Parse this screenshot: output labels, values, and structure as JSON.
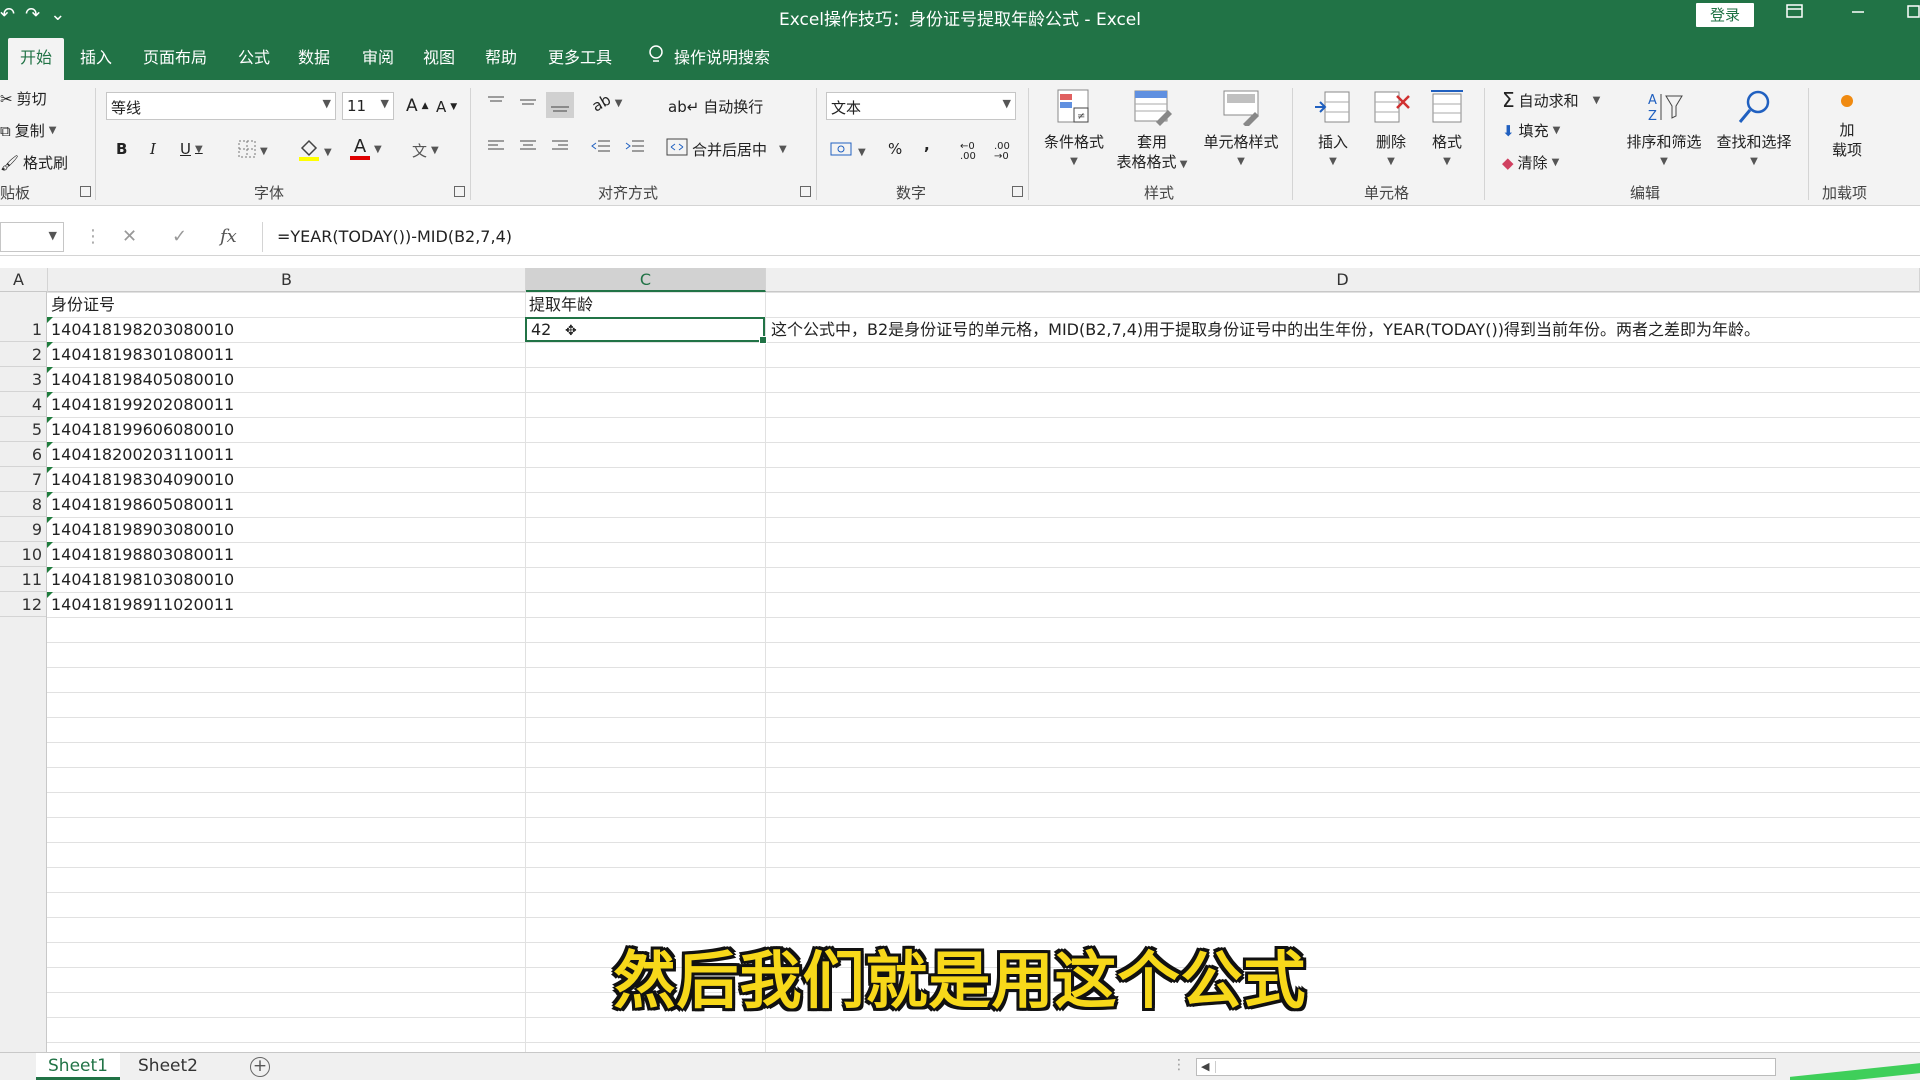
{
  "titlebar": {
    "title": "Excel操作技巧：身份证号提取年龄公式 - Excel",
    "login_label": "登录",
    "qat_undo": "↶",
    "qat_redo": "↷",
    "qat_more": "⌄"
  },
  "tabs": [
    {
      "label": "开始",
      "active": true
    },
    {
      "label": "插入"
    },
    {
      "label": "页面布局"
    },
    {
      "label": "公式"
    },
    {
      "label": "数据"
    },
    {
      "label": "审阅"
    },
    {
      "label": "视图"
    },
    {
      "label": "帮助"
    },
    {
      "label": "更多工具"
    }
  ],
  "tell_me": "操作说明搜索",
  "ribbon": {
    "clipboard": {
      "cut": "剪切",
      "copy": "复制",
      "format_painter": "格式刷",
      "group": "贴板"
    },
    "font": {
      "name": "等线",
      "size": "11",
      "bold": "B",
      "italic": "I",
      "underline": "U",
      "grow": "A",
      "shrink": "A",
      "color_letter": "A",
      "wen": "文",
      "group": "字体"
    },
    "alignment": {
      "wrap": "自动换行",
      "merge": "合并后居中",
      "group": "对齐方式"
    },
    "number": {
      "format": "文本",
      "percent": "%",
      "comma": ",",
      "group": "数字"
    },
    "styles": {
      "conditional": "条件格式",
      "table_1": "套用",
      "table_2": "表格格式",
      "cell_styles": "单元格样式",
      "group": "样式"
    },
    "cells": {
      "insert": "插入",
      "delete": "删除",
      "format": "格式",
      "group": "单元格"
    },
    "editing": {
      "autosum": "自动求和",
      "fill": "填充",
      "clear": "清除",
      "sort": "排序和筛选",
      "find": "查找和选择",
      "group": "编辑"
    },
    "addins": {
      "label_1": "加",
      "label_2": "载项",
      "group": "加载项"
    }
  },
  "formula_bar": {
    "fx": "fx",
    "formula": "=YEAR(TODAY())-MID(B2,7,4)"
  },
  "columns": [
    "A",
    "B",
    "C",
    "D"
  ],
  "headers": {
    "b": "身份证号",
    "c": "提取年龄"
  },
  "rows": [
    {
      "n": "1",
      "id": "140418198203080010",
      "age": "42"
    },
    {
      "n": "2",
      "id": "140418198301080011"
    },
    {
      "n": "3",
      "id": "140418198405080010"
    },
    {
      "n": "4",
      "id": "140418199202080011"
    },
    {
      "n": "5",
      "id": "140418199606080010"
    },
    {
      "n": "6",
      "id": "140418200203110011"
    },
    {
      "n": "7",
      "id": "140418198304090010"
    },
    {
      "n": "8",
      "id": "140418198605080011"
    },
    {
      "n": "9",
      "id": "140418198903080010"
    },
    {
      "n": "10",
      "id": "140418198803080011"
    },
    {
      "n": "11",
      "id": "140418198103080010"
    },
    {
      "n": "12",
      "id": "140418198911020011"
    }
  ],
  "note_d": "这个公式中，B2是身份证号的单元格，MID(B2,7,4)用于提取身份证号中的出生年份，YEAR(TODAY())得到当前年份。两者之差即为年龄。",
  "subtitle": "然后我们就是用这个公式",
  "sheets": [
    "Sheet1",
    "Sheet2"
  ],
  "add_sheet": "+",
  "colors": {
    "accent": "#217346",
    "subtitle": "#f7d81a"
  }
}
